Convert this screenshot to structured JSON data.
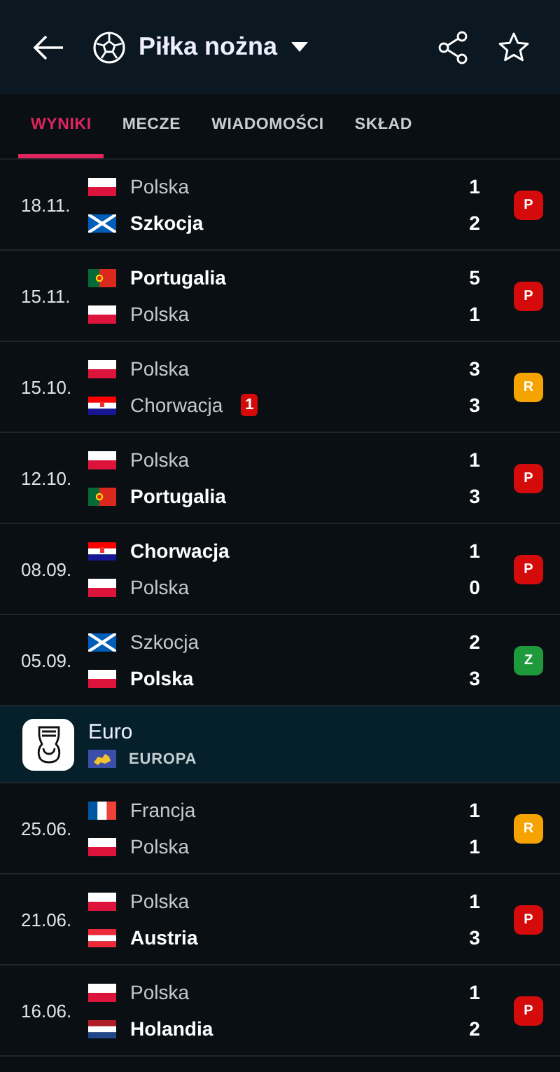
{
  "header": {
    "title": "Piłka nożna"
  },
  "tabs": [
    {
      "label": "WYNIKI",
      "selected": true
    },
    {
      "label": "MECZE",
      "selected": false
    },
    {
      "label": "WIADOMOŚCI",
      "selected": false
    },
    {
      "label": "SKŁAD",
      "selected": false
    }
  ],
  "sections": [
    {
      "matches": [
        {
          "date": "18.11.",
          "result": {
            "label": "P",
            "kind": "loss"
          },
          "teams": [
            {
              "kind": "pl",
              "name": "Polska",
              "winner": false,
              "score": "1"
            },
            {
              "kind": "sco",
              "name": "Szkocja",
              "winner": true,
              "score": "2"
            }
          ]
        },
        {
          "date": "15.11.",
          "result": {
            "label": "P",
            "kind": "loss"
          },
          "teams": [
            {
              "kind": "por",
              "name": "Portugalia",
              "winner": true,
              "score": "5"
            },
            {
              "kind": "pl",
              "name": "Polska",
              "winner": false,
              "score": "1"
            }
          ]
        },
        {
          "date": "15.10.",
          "result": {
            "label": "R",
            "kind": "draw"
          },
          "teams": [
            {
              "kind": "pl",
              "name": "Polska",
              "winner": false,
              "score": "3"
            },
            {
              "kind": "cro",
              "name": "Chorwacja",
              "winner": false,
              "score": "3",
              "red_cards": "1"
            }
          ]
        },
        {
          "date": "12.10.",
          "result": {
            "label": "P",
            "kind": "loss"
          },
          "teams": [
            {
              "kind": "pl",
              "name": "Polska",
              "winner": false,
              "score": "1"
            },
            {
              "kind": "por",
              "name": "Portugalia",
              "winner": true,
              "score": "3"
            }
          ]
        },
        {
          "date": "08.09.",
          "result": {
            "label": "P",
            "kind": "loss"
          },
          "teams": [
            {
              "kind": "cro",
              "name": "Chorwacja",
              "winner": true,
              "score": "1"
            },
            {
              "kind": "pl",
              "name": "Polska",
              "winner": false,
              "score": "0"
            }
          ]
        },
        {
          "date": "05.09.",
          "result": {
            "label": "Z",
            "kind": "win"
          },
          "teams": [
            {
              "kind": "sco",
              "name": "Szkocja",
              "winner": false,
              "score": "2"
            },
            {
              "kind": "pl",
              "name": "Polska",
              "winner": true,
              "score": "3"
            }
          ]
        }
      ]
    },
    {
      "competition": {
        "name": "Euro",
        "region": "EUROPA"
      },
      "matches": [
        {
          "date": "25.06.",
          "result": {
            "label": "R",
            "kind": "draw"
          },
          "teams": [
            {
              "kind": "fra",
              "name": "Francja",
              "winner": false,
              "score": "1"
            },
            {
              "kind": "pl",
              "name": "Polska",
              "winner": false,
              "score": "1"
            }
          ]
        },
        {
          "date": "21.06.",
          "result": {
            "label": "P",
            "kind": "loss"
          },
          "teams": [
            {
              "kind": "pl",
              "name": "Polska",
              "winner": false,
              "score": "1"
            },
            {
              "kind": "aut",
              "name": "Austria",
              "winner": true,
              "score": "3"
            }
          ]
        },
        {
          "date": "16.06.",
          "result": {
            "label": "P",
            "kind": "loss"
          },
          "teams": [
            {
              "kind": "pl",
              "name": "Polska",
              "winner": false,
              "score": "1"
            },
            {
              "kind": "ned",
              "name": "Holandia",
              "winner": true,
              "score": "2"
            }
          ]
        }
      ]
    }
  ]
}
